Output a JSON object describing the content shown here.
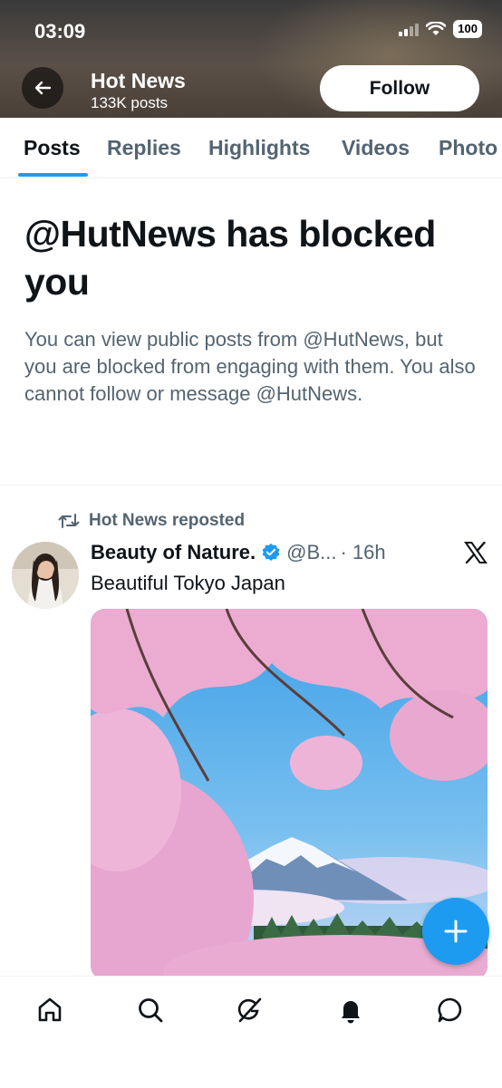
{
  "status_bar": {
    "time": "03:09",
    "battery": "100"
  },
  "header": {
    "title": "Hot News",
    "subtitle": "133K posts",
    "follow_label": "Follow"
  },
  "tabs": [
    {
      "label": "Posts",
      "active": true
    },
    {
      "label": "Replies",
      "active": false
    },
    {
      "label": "Highlights",
      "active": false
    },
    {
      "label": "Videos",
      "active": false
    },
    {
      "label": "Photo",
      "active": false
    }
  ],
  "blocked": {
    "title": "@HutNews has blocked you",
    "message": "You can view public posts from @HutNews, but you are blocked from engaging with them. You also cannot follow or message @HutNews."
  },
  "post": {
    "repost_label": "Hot News reposted",
    "author": "Beauty of Nature.",
    "handle": "@B...",
    "time": "· 16h",
    "text": "Beautiful Tokyo Japan",
    "verified": true,
    "source_icon": "x-logo-icon"
  },
  "colors": {
    "accent": "#1d9bf0",
    "text": "#0f1419",
    "secondary": "#536471"
  },
  "nav": [
    "home-icon",
    "search-icon",
    "grok-icon",
    "notifications-icon",
    "messages-icon"
  ]
}
